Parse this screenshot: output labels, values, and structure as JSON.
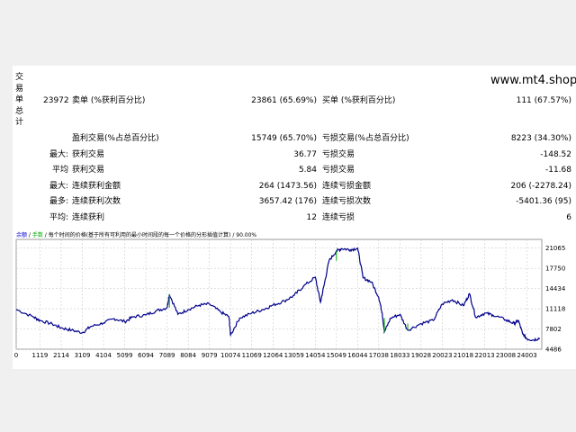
{
  "site": "www.mt4.shop",
  "side_label": [
    "交",
    "易",
    "单",
    "总",
    "计"
  ],
  "stats": {
    "total_trades": "23972",
    "short_label": "卖单 (%获利百分比)",
    "short_value": "23861 (65.69%)",
    "long_label": "买单 (%获利百分比)",
    "long_value": "111 (67.57%)",
    "profit_trades_label": "盈利交易(%占总百分比)",
    "profit_trades_value": "15749 (65.70%)",
    "loss_trades_label": "亏损交易(%占总百分比)",
    "loss_trades_value": "8223 (34.30%)",
    "largest_prefix": "最大:",
    "largest_profit_label": "获利交易",
    "largest_profit_value": "36.77",
    "largest_loss_label": "亏损交易",
    "largest_loss_value": "-148.52",
    "average_prefix": "平均",
    "average_profit_label": "获利交易",
    "average_profit_value": "5.84",
    "average_loss_label": "亏损交易",
    "average_loss_value": "-11.68",
    "max_prefix": "最大:",
    "max_consec_wins_label": "连续获利金额",
    "max_consec_wins_value": "264 (1473.56)",
    "max_consec_losses_label": "连续亏损金额",
    "max_consec_losses_value": "206 (-2278.24)",
    "maximal_prefix": "最多:",
    "maximal_consec_profit_label": "连续获利次数",
    "maximal_consec_profit_value": "3657.42 (176)",
    "maximal_consec_loss_label": "连续亏损次数",
    "maximal_consec_loss_value": "-5401.36 (95)",
    "avg_prefix": "平均:",
    "avg_consec_wins_label": "连续获利",
    "avg_consec_wins_value": "12",
    "avg_consec_losses_label": "连续亏损",
    "avg_consec_losses_value": "6"
  },
  "chart_header": {
    "part1": "余额",
    "sep1": " / ",
    "part2": "手数",
    "sep2": " / ",
    "part3": "每个时间的价格(基于所有可利用的最小时间段的每一个价格的分形插值计算)",
    "sep3": " / ",
    "part4": "90.00%"
  },
  "colors": {
    "balance": "#00008b",
    "lots": "#00aa00",
    "grid": "#c0c0c0"
  },
  "chart_data": {
    "type": "line",
    "x_ticks": [
      "0",
      "1119",
      "2114",
      "3109",
      "4104",
      "5099",
      "6094",
      "7089",
      "8084",
      "9079",
      "10074",
      "11069",
      "12064",
      "13059",
      "14054",
      "15049",
      "16044",
      "17038",
      "18033",
      "19028",
      "20023",
      "21018",
      "22013",
      "23008",
      "24003"
    ],
    "y_ticks": [
      "21065",
      "17750",
      "14434",
      "11118",
      "7802",
      "4486"
    ],
    "ylim": [
      4486,
      22500
    ],
    "xlim": [
      0,
      24700
    ],
    "series": [
      {
        "x": [
          0,
          800,
          1119,
          1700,
          2114,
          2600,
          3109,
          3500,
          4104,
          4600,
          5099,
          5500,
          6094,
          6600,
          7089,
          7200,
          7600,
          8084,
          8600,
          9079,
          9600,
          10000,
          10074,
          10500,
          11069,
          11600,
          12064,
          12600,
          13059,
          13500,
          14054,
          14300,
          14500,
          14700,
          15049,
          15300,
          15700,
          16044,
          16300,
          16700,
          17038,
          17200,
          17300,
          17600,
          18033,
          18400,
          19028,
          19600,
          20023,
          20500,
          21018,
          21300,
          21600,
          22013,
          22400,
          23008,
          23400,
          23600,
          23800,
          24003,
          24300,
          24600
        ],
        "values": [
          11000,
          9800,
          9200,
          8600,
          8000,
          7600,
          7200,
          8200,
          8800,
          9500,
          9000,
          9800,
          10100,
          10800,
          11300,
          13500,
          10200,
          11000,
          11700,
          11900,
          10600,
          9800,
          6800,
          9600,
          10400,
          11000,
          11700,
          12400,
          13300,
          14800,
          16300,
          12200,
          15500,
          19000,
          20600,
          21000,
          20800,
          21065,
          16200,
          15500,
          13000,
          10400,
          7300,
          9600,
          10200,
          7600,
          8700,
          9200,
          11900,
          12600,
          11600,
          13600,
          9700,
          10400,
          10100,
          9300,
          8700,
          9200,
          7000,
          6200,
          6000,
          6300
        ]
      }
    ]
  }
}
